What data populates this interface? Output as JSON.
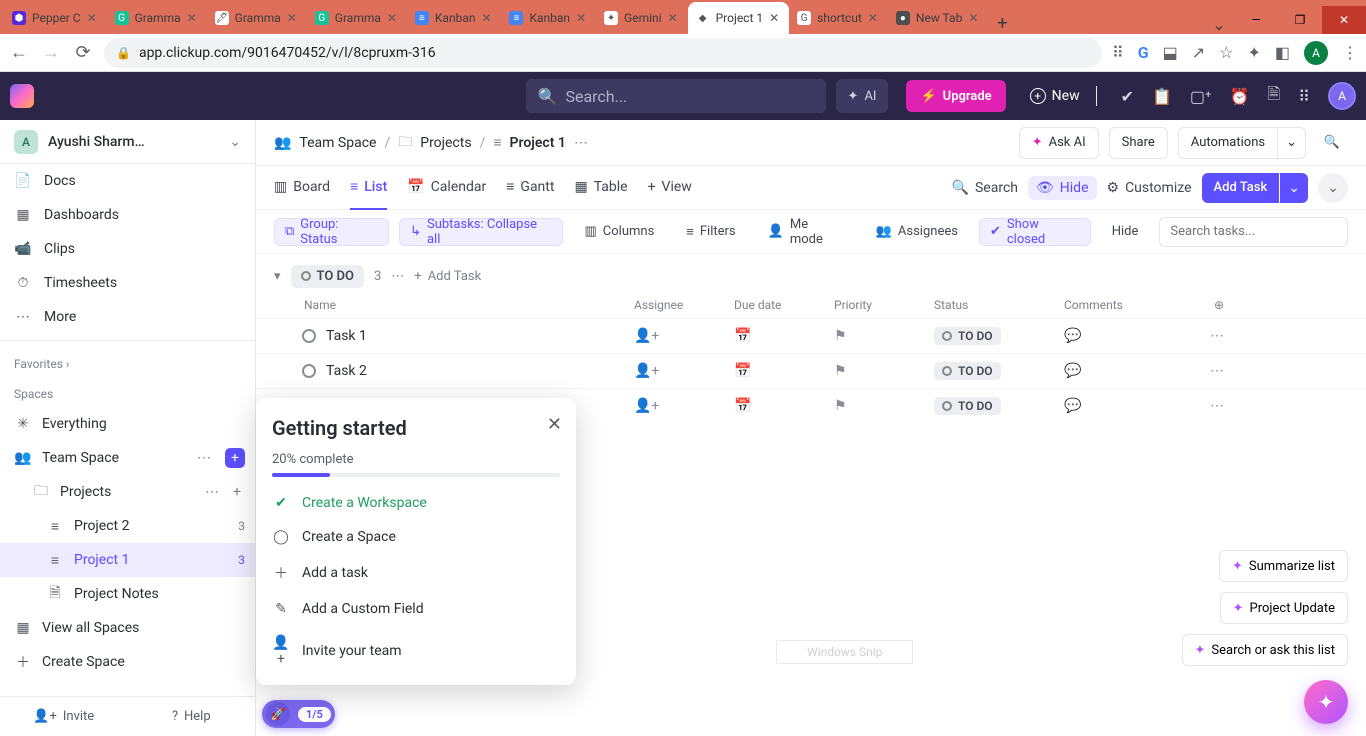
{
  "browser": {
    "tabs": [
      {
        "title": "Pepper C",
        "favicon_bg": "#5529d9",
        "favicon_txt": "⬢"
      },
      {
        "title": "Gramma",
        "favicon_bg": "#15c39a",
        "favicon_txt": "G"
      },
      {
        "title": "Gramma",
        "favicon_bg": "#ffffff",
        "favicon_txt": "🖋"
      },
      {
        "title": "Gramma",
        "favicon_bg": "#15c39a",
        "favicon_txt": "G"
      },
      {
        "title": "Kanban",
        "favicon_bg": "#4285f4",
        "favicon_txt": "≡"
      },
      {
        "title": "Kanban",
        "favicon_bg": "#4285f4",
        "favicon_txt": "≡"
      },
      {
        "title": "Gemini",
        "favicon_bg": "#ffffff",
        "favicon_txt": "✦"
      },
      {
        "title": "Project 1",
        "favicon_bg": "#ffffff",
        "favicon_txt": "◆",
        "active": true
      },
      {
        "title": "shortcut",
        "favicon_bg": "#ffffff",
        "favicon_txt": "G"
      },
      {
        "title": "New Tab",
        "favicon_bg": "#4d4d4d",
        "favicon_txt": "●"
      }
    ],
    "url": "app.clickup.com/9016470452/v/l/8cpruxm-316",
    "avatar_letter": "A"
  },
  "app": {
    "search_placeholder": "Search...",
    "ai_label": "AI",
    "upgrade_label": "Upgrade",
    "new_label": "New",
    "avatar_letter": "A"
  },
  "sidebar": {
    "workspace_avatar": "A",
    "workspace_name": "Ayushi Sharm…",
    "nav": [
      {
        "icon": "📄",
        "label": "Docs"
      },
      {
        "icon": "▦",
        "label": "Dashboards"
      },
      {
        "icon": "📹",
        "label": "Clips"
      },
      {
        "icon": "⏱",
        "label": "Timesheets"
      },
      {
        "icon": "⋯",
        "label": "More"
      }
    ],
    "favorites_label": "Favorites",
    "spaces_label": "Spaces",
    "everything": {
      "icon": "✳",
      "label": "Everything"
    },
    "team_space": {
      "icon": "👥",
      "label": "Team Space"
    },
    "projects_folder": "Projects",
    "lists": [
      {
        "label": "Project 2",
        "count": "3"
      },
      {
        "label": "Project 1",
        "count": "3",
        "active": true
      },
      {
        "label": "Project Notes",
        "icon": "🗎"
      }
    ],
    "view_all": "View all Spaces",
    "create_space": "Create Space",
    "invite": "Invite",
    "help": "Help"
  },
  "breadcrumb": {
    "space": "Team Space",
    "folder": "Projects",
    "list": "Project 1",
    "ask_ai": "Ask AI",
    "share": "Share",
    "automations": "Automations"
  },
  "views": {
    "tabs": [
      "Board",
      "List",
      "Calendar",
      "Gantt",
      "Table",
      "View"
    ],
    "active": "List",
    "search": "Search",
    "hide": "Hide",
    "customize": "Customize",
    "add_task": "Add Task"
  },
  "filters": {
    "group": "Group: Status",
    "subtasks": "Subtasks: Collapse all",
    "columns": "Columns",
    "filters": "Filters",
    "me_mode": "Me mode",
    "assignees": "Assignees",
    "show_closed": "Show closed",
    "hide": "Hide",
    "search_placeholder": "Search tasks..."
  },
  "group": {
    "status_label": "TO DO",
    "count": "3",
    "add_task": "Add Task",
    "columns": [
      "Name",
      "Assignee",
      "Due date",
      "Priority",
      "Status",
      "Comments"
    ]
  },
  "tasks": [
    {
      "name": "Task 1",
      "status": "TO DO"
    },
    {
      "name": "Task 2",
      "status": "TO DO"
    },
    {
      "name": "",
      "status": "TO DO"
    }
  ],
  "getting_started": {
    "title": "Getting started",
    "progress_text": "20% complete",
    "progress_pct": 20,
    "items": [
      {
        "label": "Create a Workspace",
        "done": true,
        "icon": "✔"
      },
      {
        "label": "Create a Space",
        "done": false,
        "icon": "◯"
      },
      {
        "label": "Add a task",
        "done": false,
        "icon": "＋"
      },
      {
        "label": "Add a Custom Field",
        "done": false,
        "icon": "✎"
      },
      {
        "label": "Invite your team",
        "done": false,
        "icon": "👤+"
      }
    ]
  },
  "onboarding_pill": "1/5",
  "float": [
    "Summarize list",
    "Project Update",
    "Search or ask this list"
  ],
  "watermark": "Windows Snip"
}
